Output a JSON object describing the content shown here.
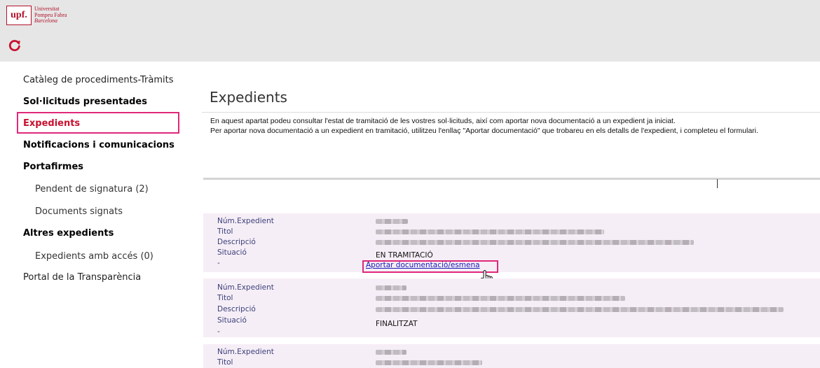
{
  "header": {
    "logo_mark": "upf.",
    "logo_lines": [
      "Universitat",
      "Pompeu Fabra",
      "Barcelona"
    ],
    "refresh_icon": "refresh-icon"
  },
  "sidebar": {
    "items": [
      {
        "label": "Catàleg de procediments-Tràmits"
      },
      {
        "label": "Sol·licituds presentades"
      },
      {
        "label": "Expedients"
      },
      {
        "label": "Notificacions i comunicacions"
      },
      {
        "label": "Portafirmes"
      },
      {
        "label": "Pendent de signatura (2)"
      },
      {
        "label": "Documents signats"
      },
      {
        "label": "Altres expedients"
      },
      {
        "label": "Expedients amb accés (0)"
      },
      {
        "label": "Portal de la Transparència"
      }
    ]
  },
  "main": {
    "title": "Expedients",
    "description": [
      "En aquest apartat podeu consultar l'estat de tramitació de les vostres sol·licituds, així com aportar nova documentació a un expedient ja iniciat.",
      "Per aportar nova documentació a un expedient en tramitació, utilitzeu l'enllaç \"Aportar documentació\" que trobareu en els detalls de l'expedient, i completeu el formulari."
    ]
  },
  "cards": {
    "labels": {
      "num": "Núm.Expedient",
      "titol": "Titol",
      "descripcio": "Descripció",
      "situacio": "Situació",
      "dash": "-"
    },
    "items": [
      {
        "situacio": "EN TRAMITACIÓ",
        "link": "Aportar documentació/esmena"
      },
      {
        "situacio": "FINALITZAT"
      },
      {}
    ]
  },
  "colors": {
    "brand": "#b0122a",
    "highlight": "#e0287a",
    "card_bg": "#f6eef6",
    "label": "#3a3f7a"
  }
}
